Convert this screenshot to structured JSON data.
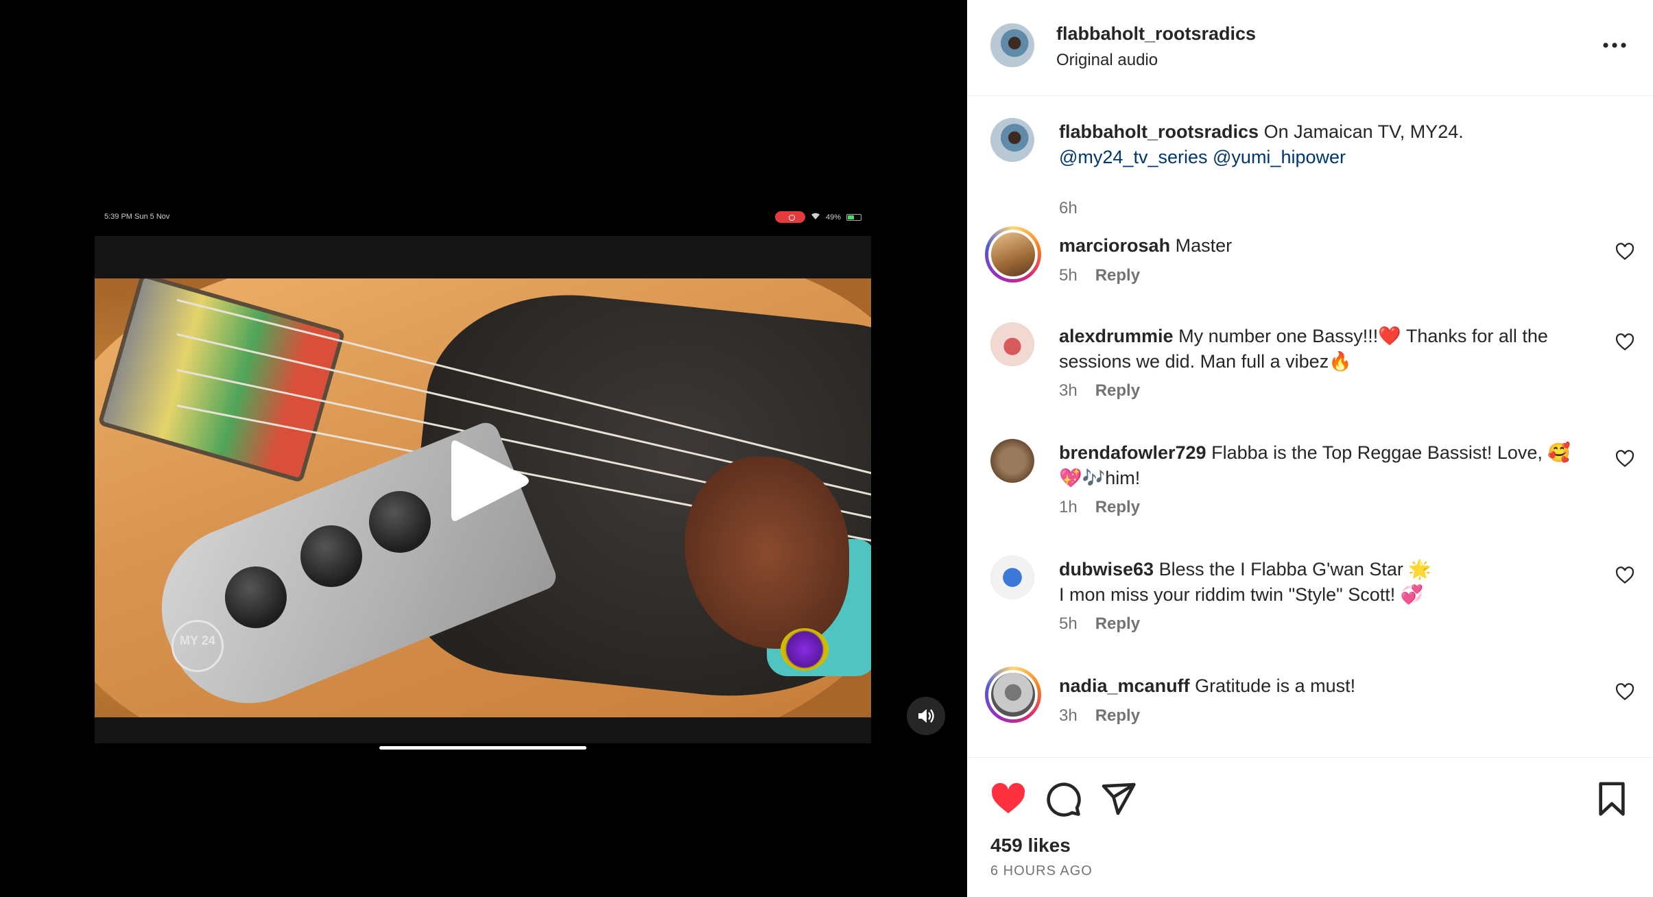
{
  "video": {
    "status_time": "5:39 PM  Sun 5 Nov",
    "status_battery": "49%",
    "channel_logo": "MY 24",
    "play_icon": "play-icon",
    "mute_icon": "speaker-icon"
  },
  "post": {
    "author": "flabbaholt_rootsradics",
    "audio": "Original audio",
    "caption_user": "flabbaholt_rootsradics",
    "caption_text": "On Jamaican TV, MY24.",
    "mention_1": "@my24_tv_series",
    "mention_2": "@yumi_hipower",
    "caption_time": "6h"
  },
  "comments": [
    {
      "user": "marciorosah",
      "text": "Master",
      "time": "5h",
      "reply": "Reply"
    },
    {
      "user": "alexdrummie",
      "text": "My number one Bassy!!!❤️ Thanks for all the sessions we did. Man full a vibez🔥",
      "time": "3h",
      "reply": "Reply"
    },
    {
      "user": "brendafowler729",
      "text": "Flabba is the Top Reggae Bassist! Love, 🥰💖🎶him!",
      "time": "1h",
      "reply": "Reply"
    },
    {
      "user": "dubwise63",
      "text": "Bless the I Flabba G'wan Star 🌟",
      "text2": "I mon miss your riddim twin \"Style\" Scott! 💞",
      "time": "5h",
      "reply": "Reply"
    },
    {
      "user": "nadia_mcanuff",
      "text": "Gratitude is a must!",
      "time": "3h",
      "reply": "Reply"
    }
  ],
  "actions": {
    "likes": "459 likes",
    "posted": "6 HOURS AGO",
    "like_color": "#ff3040"
  },
  "colors": {
    "text": "#262626",
    "secondary": "#737373",
    "link": "#00376b",
    "divider": "#efefef"
  }
}
